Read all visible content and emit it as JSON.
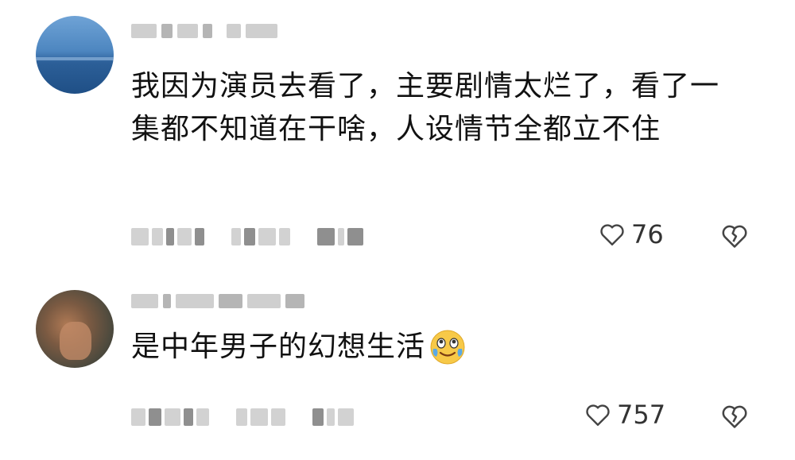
{
  "comments": [
    {
      "text": "我因为演员去看了，主要剧情太烂了，看了一集都不知道在干啥，人设情节全都立不住",
      "likes": "76",
      "avatar_icon": "sea-horizon-avatar",
      "like_icon": "heart-outline-icon",
      "dislike_icon": "broken-heart-icon"
    },
    {
      "text": "是中年男子的幻想生活",
      "emoji": "crying-laughing-emoji",
      "likes": "757",
      "avatar_icon": "blurred-photo-avatar",
      "like_icon": "heart-outline-icon",
      "dislike_icon": "broken-heart-icon"
    }
  ]
}
